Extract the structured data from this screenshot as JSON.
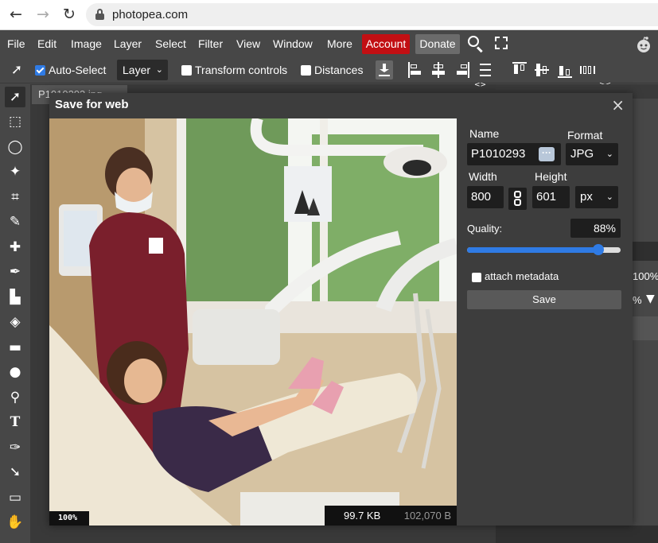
{
  "browser": {
    "back_icon": "arrow-left-icon",
    "forward_icon": "arrow-right-icon",
    "reload_icon": "reload-icon",
    "url": "photopea.com"
  },
  "menu": {
    "items": [
      "File",
      "Edit",
      "Image",
      "Layer",
      "Select",
      "Filter",
      "View",
      "Window",
      "More"
    ],
    "account": "Account",
    "donate": "Donate"
  },
  "options": {
    "auto_select": "Auto-Select",
    "auto_select_checked": true,
    "layer_select": "Layer",
    "transform_controls": "Transform controls",
    "distances": "Distances"
  },
  "workspace": {
    "doc_tab": "P1010293.jpg"
  },
  "right_panel": {
    "opacity_value": "100%",
    "fill_value": "%"
  },
  "dialog": {
    "title": "Save for web",
    "close": "×",
    "preview": {
      "zoom": "100%",
      "new_size": "99.7 KB",
      "original_size": "102,070 B"
    },
    "form": {
      "name_label": "Name",
      "name_value": "P1010293",
      "dots": "···",
      "format_label": "Format",
      "format_value": "JPG",
      "width_label": "Width",
      "width_value": "800",
      "height_label": "Height",
      "height_value": "601",
      "unit_value": "px",
      "quality_label": "Quality:",
      "quality_value": "88%",
      "quality_level": 0.88,
      "metadata_label": "attach metadata",
      "metadata_checked": false,
      "save_label": "Save"
    }
  },
  "colors": {
    "account_red": "#c20f13",
    "accent_blue": "#2f7be5",
    "dialog_bg": "#3d3d3d",
    "menubar_bg": "#474747"
  }
}
